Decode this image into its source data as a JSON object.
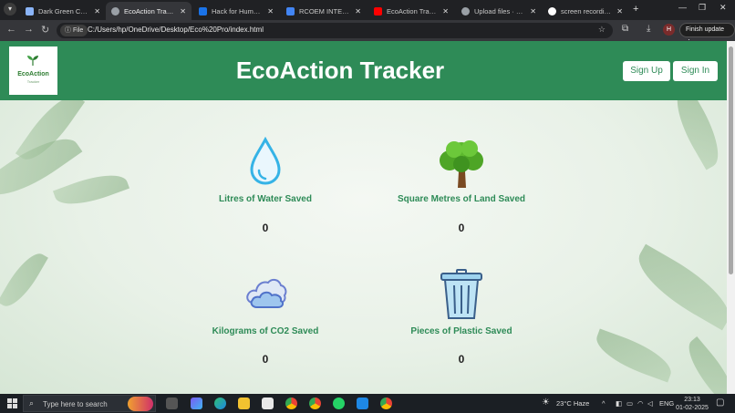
{
  "browser": {
    "tabs": [
      {
        "label": "Dark Green Color Pa",
        "favicon_color": "#8ab4f8",
        "active": false
      },
      {
        "label": "EcoAction Tracker",
        "favicon_color": "#9aa0a6",
        "active": true
      },
      {
        "label": "Hack for Humanity |",
        "favicon_color": "#1a73e8",
        "active": false
      },
      {
        "label": "RCOEM INTERNET P",
        "favicon_color": "#4285f4",
        "active": false
      },
      {
        "label": "EcoAction Tracker -",
        "favicon_color": "#ff0000",
        "active": false
      },
      {
        "label": "Upload files · Himan",
        "favicon_color": "#9aa0a6",
        "active": false
      },
      {
        "label": "screen recording sh",
        "favicon_color": "#ffffff",
        "active": false
      }
    ],
    "address": {
      "scheme_chip": "File",
      "url": "C:/Users/hp/OneDrive/Desktop/Eco%20Pro/index.html"
    },
    "profile_initial": "H",
    "finish_update_label": "Finish update"
  },
  "site": {
    "logo_text": "EcoAction",
    "logo_subtext": "Tracker",
    "title": "EcoAction Tracker",
    "signup_label": "Sign Up",
    "signin_label": "Sign In",
    "brand_color": "#2e8b57",
    "stats": [
      {
        "icon": "water-drop-icon",
        "label": "Litres of Water Saved",
        "value": "0"
      },
      {
        "icon": "tree-icon",
        "label": "Square Metres of Land Saved",
        "value": "0"
      },
      {
        "icon": "cloud-icon",
        "label": "Kilograms of CO2 Saved",
        "value": "0"
      },
      {
        "icon": "trash-bin-icon",
        "label": "Pieces of Plastic Saved",
        "value": "0"
      }
    ]
  },
  "taskbar": {
    "search_placeholder": "Type here to search",
    "weather": "23°C  Haze",
    "language": "ENG",
    "time": "23:13",
    "date": "01-02-2025"
  }
}
